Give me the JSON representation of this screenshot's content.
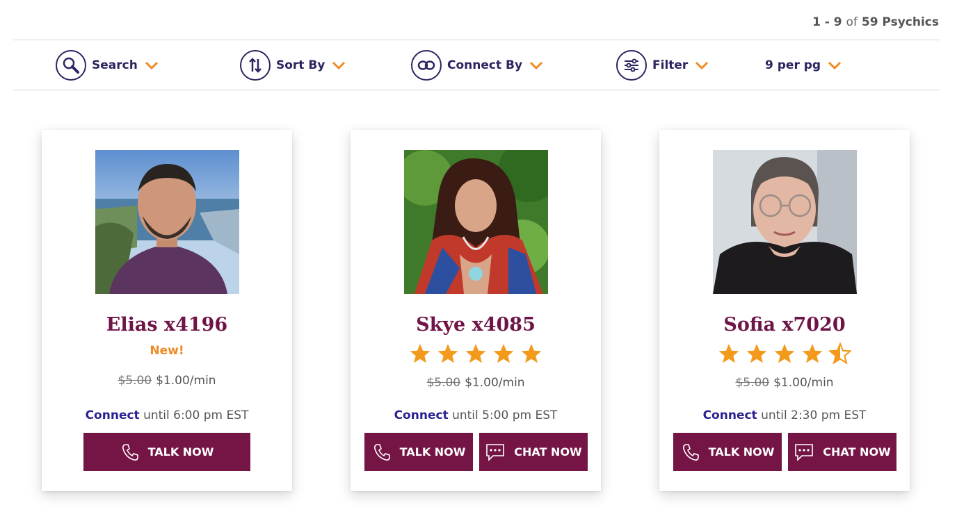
{
  "results": {
    "range": "1 - 9",
    "of": "of",
    "total": "59 Psychics"
  },
  "toolbar": {
    "search": "Search",
    "sort": "Sort By",
    "connect": "Connect By",
    "filter": "Filter",
    "per_page": "9 per pg"
  },
  "colors": {
    "accent": "#f08a24",
    "brand": "#751545",
    "navy": "#2a2560",
    "name": "#6e1447"
  },
  "psychics": [
    {
      "name": "Elias x4196",
      "badge": "New!",
      "rating_stars": null,
      "old_price": "$5.00",
      "price": "$1.00/min",
      "connect_label": "Connect",
      "availability": "until 6:00 pm EST",
      "talk_label": "TALK NOW",
      "chat_label": null
    },
    {
      "name": "Skye x4085",
      "badge": null,
      "rating_stars": 5,
      "old_price": "$5.00",
      "price": "$1.00/min",
      "connect_label": "Connect",
      "availability": "until 5:00 pm EST",
      "talk_label": "TALK NOW",
      "chat_label": "CHAT NOW"
    },
    {
      "name": "Sofia x7020",
      "badge": null,
      "rating_stars": 4.5,
      "old_price": "$5.00",
      "price": "$1.00/min",
      "connect_label": "Connect",
      "availability": "until 2:30 pm EST",
      "talk_label": "TALK NOW",
      "chat_label": "CHAT NOW"
    }
  ]
}
